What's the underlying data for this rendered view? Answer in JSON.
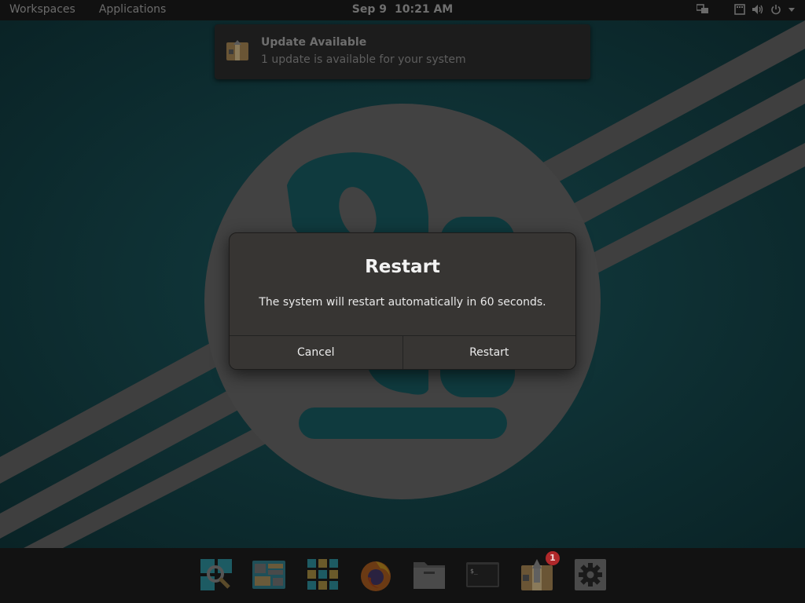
{
  "topbar": {
    "workspaces_label": "Workspaces",
    "applications_label": "Applications",
    "date": "Sep 9",
    "time": "10:21 AM"
  },
  "notification": {
    "icon": "package-update-icon",
    "title": "Update Available",
    "body": "1 update is available for your system"
  },
  "dialog": {
    "title": "Restart",
    "message": "The system will restart automatically in 60 seconds.",
    "cancel_label": "Cancel",
    "restart_label": "Restart"
  },
  "dock": {
    "items": [
      {
        "icon": "search-icon"
      },
      {
        "icon": "workspaces-icon"
      },
      {
        "icon": "app-grid-icon"
      },
      {
        "icon": "firefox-icon"
      },
      {
        "icon": "files-icon"
      },
      {
        "icon": "terminal-icon"
      },
      {
        "icon": "pop-shop-icon",
        "badge": "1"
      },
      {
        "icon": "settings-icon"
      }
    ]
  },
  "colors": {
    "wallpaper_teal": "#0f3a3e",
    "dialog_bg": "#373533",
    "badge_red": "#b0282a"
  }
}
